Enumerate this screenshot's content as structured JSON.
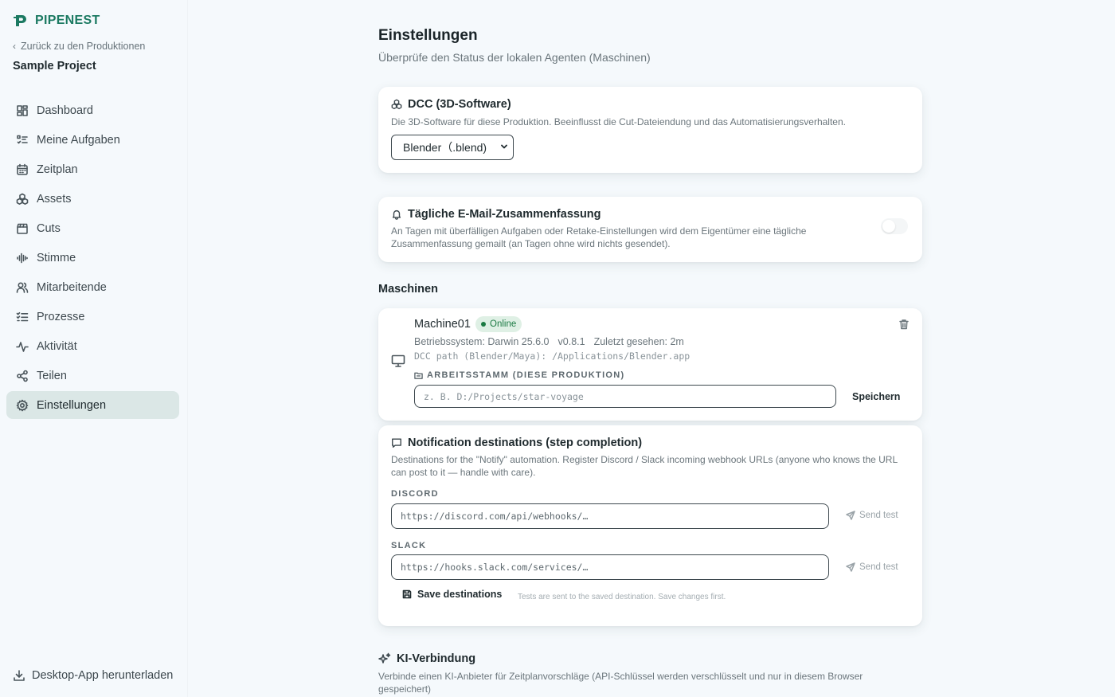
{
  "brand": {
    "name": "PIPENEST",
    "color": "#1c7a62"
  },
  "sidebar": {
    "back_label": "Zurück zu den Produktionen",
    "project_name": "Sample Project",
    "items": [
      {
        "label": "Dashboard",
        "icon": "dashboard-icon"
      },
      {
        "label": "Meine Aufgaben",
        "icon": "task-list-icon"
      },
      {
        "label": "Zeitplan",
        "icon": "calendar-icon"
      },
      {
        "label": "Assets",
        "icon": "assets-icon"
      },
      {
        "label": "Cuts",
        "icon": "clapperboard-icon"
      },
      {
        "label": "Stimme",
        "icon": "audio-wave-icon"
      },
      {
        "label": "Mitarbeitende",
        "icon": "users-icon"
      },
      {
        "label": "Prozesse",
        "icon": "checklist-icon"
      },
      {
        "label": "Aktivität",
        "icon": "activity-icon"
      },
      {
        "label": "Teilen",
        "icon": "share-icon"
      },
      {
        "label": "Einstellungen",
        "icon": "gear-icon",
        "active": true
      }
    ],
    "download_label": "Desktop-App herunterladen"
  },
  "page": {
    "title": "Einstellungen",
    "subtitle": "Überprüfe den Status der lokalen Agenten (Maschinen)"
  },
  "dcc": {
    "title": "DCC (3D-Software)",
    "description": "Die 3D-Software für diese Produktion. Beeinflusst die Cut-Dateiendung und das Automatisierungsverhalten.",
    "selected": "Blender（.blend)"
  },
  "email": {
    "title": "Tägliche E-Mail-Zusammenfassung",
    "description": "An Tagen mit überfälligen Aufgaben oder Retake-Einstellungen wird dem Eigentümer eine tägliche Zusammenfassung gemailt (an Tagen ohne wird nichts gesendet).",
    "enabled": false
  },
  "machines": {
    "heading": "Maschinen",
    "list": [
      {
        "name": "Machine01",
        "status": "Online",
        "os": "Betriebssystem: Darwin 25.6.0",
        "version": "v0.8.1",
        "last_seen": "Zuletzt gesehen: 2m",
        "dcc_path": "DCC path (Blender/Maya): /Applications/Blender.app",
        "root_label": "ARBEITSSTAMM (DIESE PRODUKTION)",
        "root_placeholder": "z. B. D:/Projects/star-voyage",
        "save_label": "Speichern"
      }
    ]
  },
  "notify": {
    "title": "Notification destinations (step completion)",
    "description": "Destinations for the \"Notify\" automation. Register Discord / Slack incoming webhook URLs (anyone who knows the URL can post to it — handle with care).",
    "discord_label": "DISCORD",
    "discord_placeholder": "https://discord.com/api/webhooks/…",
    "slack_label": "SLACK",
    "slack_placeholder": "https://hooks.slack.com/services/…",
    "send_test_label": "Send test",
    "save_label": "Save destinations",
    "hint": "Tests are sent to the saved destination. Save changes first."
  },
  "ai": {
    "title": "KI-Verbindung",
    "description": "Verbinde einen KI-Anbieter für Zeitplanvorschläge (API-Schlüssel werden verschlüsselt und nur in diesem Browser gespeichert)"
  }
}
